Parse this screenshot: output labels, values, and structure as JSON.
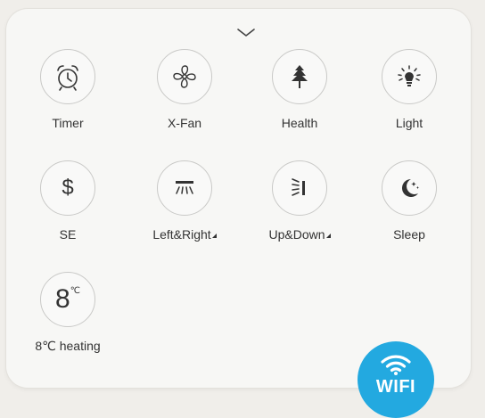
{
  "panel": {
    "collapse_icon": "chevron-down-icon",
    "accent_color": "#23a9e0",
    "tiles": [
      {
        "id": "timer",
        "label": "Timer",
        "icon": "alarm-clock-icon"
      },
      {
        "id": "xfan",
        "label": "X-Fan",
        "icon": "fan-icon"
      },
      {
        "id": "health",
        "label": "Health",
        "icon": "tree-icon"
      },
      {
        "id": "light",
        "label": "Light",
        "icon": "light-bulb-icon"
      },
      {
        "id": "se",
        "label": "SE",
        "icon": "dollar-icon",
        "glyph": "$"
      },
      {
        "id": "left-right",
        "label": "Left&Right",
        "icon": "swing-horizontal-icon"
      },
      {
        "id": "up-down",
        "label": "Up&Down",
        "icon": "swing-vertical-icon"
      },
      {
        "id": "sleep",
        "label": "Sleep",
        "icon": "moon-stars-icon"
      },
      {
        "id": "heating",
        "label": "8℃ heating",
        "icon": "eight-degree-icon",
        "glyph": "8",
        "glyph_unit": "℃"
      }
    ]
  },
  "badge": {
    "text": "WIFI",
    "icon": "wifi-icon",
    "color": "#23a9e0"
  }
}
